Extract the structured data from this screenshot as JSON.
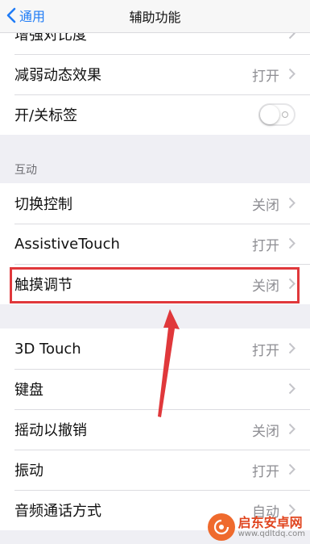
{
  "navbar": {
    "back_label": "通用",
    "title": "辅助功能"
  },
  "group1": [
    {
      "label": "增强对比度",
      "value": ""
    },
    {
      "label": "减弱动态效果",
      "value": "打开"
    },
    {
      "label": "开/关标签",
      "toggle": false
    }
  ],
  "section_interaction": {
    "header": "互动"
  },
  "group2": [
    {
      "label": "切换控制",
      "value": "关闭"
    },
    {
      "label": "AssistiveTouch",
      "value": "打开"
    },
    {
      "label": "触摸调节",
      "value": "关闭"
    }
  ],
  "group3": [
    {
      "label": "3D Touch",
      "value": "打开"
    },
    {
      "label": "键盘",
      "value": ""
    },
    {
      "label": "摇动以撤销",
      "value": "关闭"
    },
    {
      "label": "振动",
      "value": "打开"
    },
    {
      "label": "音频通话方式",
      "value": "自动"
    }
  ],
  "annotation": {
    "highlight_color": "#e0383b"
  },
  "watermark": {
    "name": "启东安卓网",
    "url": "www.qdltdq.com"
  },
  "colors": {
    "accent": "#1f7cf6",
    "background": "#efeff4"
  }
}
